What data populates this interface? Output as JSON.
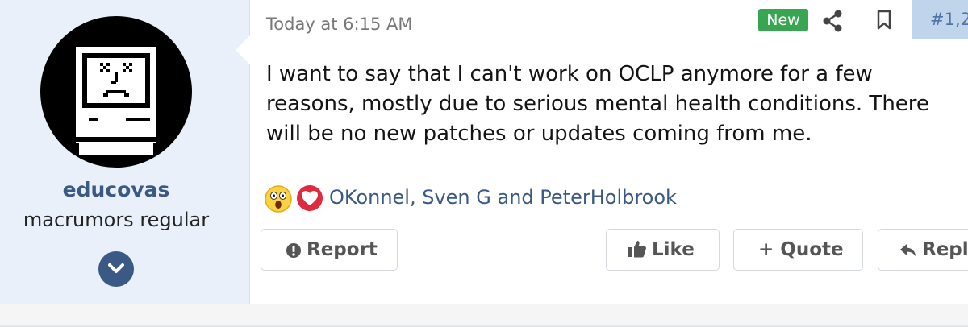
{
  "user": {
    "username": "educovas",
    "title": "macrumors regular"
  },
  "post": {
    "timestamp": "Today at 6:15 AM",
    "badge": "New",
    "number": "#1,2",
    "message": "I want to say that I can't work on OCLP anymore for a few\nreasons, mostly due to serious mental health conditions. There\nwill be no new patches or updates coming from me."
  },
  "reactions": {
    "names": "OKonnel, Sven G and PeterHolbrook",
    "icons": [
      "shocked-emoji-icon",
      "heart-love-icon"
    ]
  },
  "actions": {
    "report_label": "Report",
    "like_label": "Like",
    "quote_label": "+ Quote",
    "reply_label": "Repl"
  },
  "colors": {
    "accent": "#3a5a85",
    "user_panel": "#e9f0f9",
    "new_badge": "#37a551",
    "post_number_bg": "#c0d4ec"
  }
}
